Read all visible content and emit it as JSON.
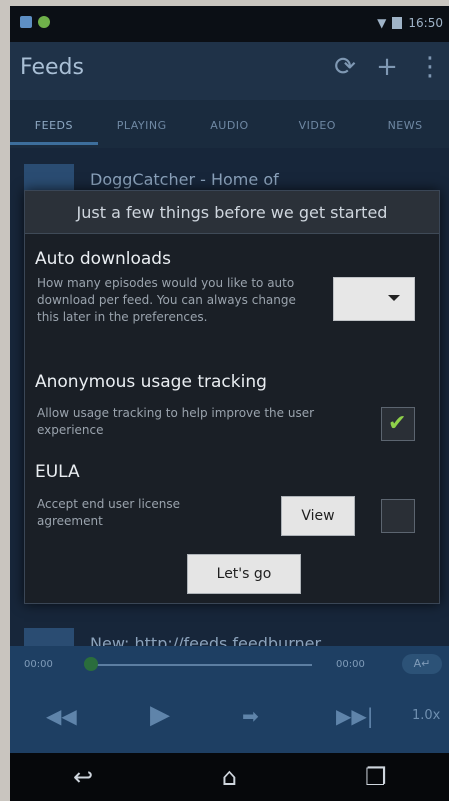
{
  "status_bar": {
    "time": "16:50"
  },
  "action_bar": {
    "title": "Feeds"
  },
  "tabs": [
    {
      "label": "FEEDS",
      "active": true
    },
    {
      "label": "PLAYING",
      "active": false
    },
    {
      "label": "AUDIO",
      "active": false
    },
    {
      "label": "VIDEO",
      "active": false
    },
    {
      "label": "NEWS",
      "active": false
    }
  ],
  "list": {
    "items": [
      {
        "title": "DoggCatcher - Home of"
      },
      {
        "title": "New: http://feeds.feedburner"
      }
    ]
  },
  "dialog": {
    "title": "Just a few things before we get started",
    "auto_downloads": {
      "heading": "Auto downloads",
      "description": "How many episodes would you like to auto download per feed.  You can always change this later in the preferences."
    },
    "usage_tracking": {
      "heading": "Anonymous usage tracking",
      "description": "Allow usage tracking to help improve the user experience",
      "checked": true
    },
    "eula": {
      "heading": "EULA",
      "description": "Accept end user license agreement",
      "view_label": "View",
      "checked": false
    },
    "go_label": "Let's go"
  },
  "player": {
    "time_elapsed": "00:00",
    "time_total": "00:00",
    "chip": "A↵",
    "speed": "1.0x"
  },
  "icons": {
    "refresh": "refresh-icon",
    "add": "add-icon",
    "overflow": "overflow-menu-icon",
    "checkmark": "checkmark-icon"
  },
  "colors": {
    "action_bar": "#1f3248",
    "dialog_bg": "#1a1f26",
    "check_green": "#8fd14a",
    "player_bg": "#1e3f63"
  }
}
